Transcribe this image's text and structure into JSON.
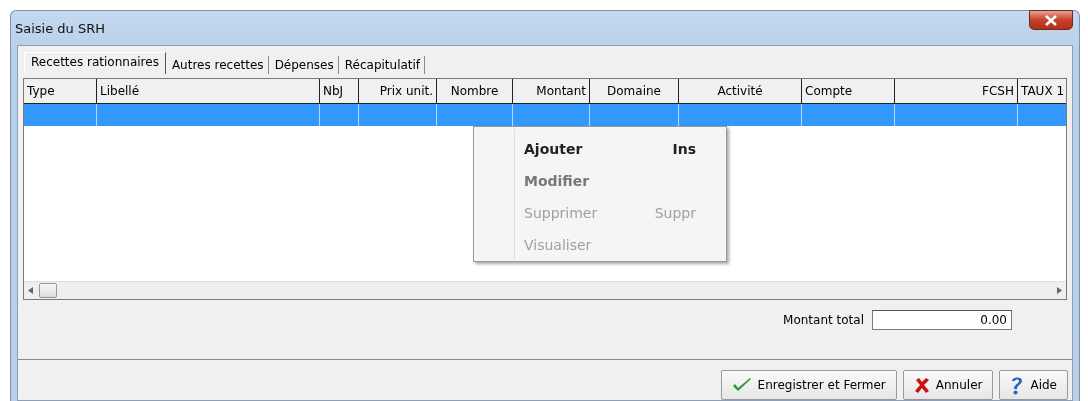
{
  "window": {
    "title": "Saisie du SRH"
  },
  "tabs": [
    {
      "label": "Recettes rationnaires",
      "selected": true
    },
    {
      "label": "Autres recettes",
      "selected": false
    },
    {
      "label": "Dépenses",
      "selected": false
    },
    {
      "label": "Récapitulatif",
      "selected": false
    }
  ],
  "table": {
    "columns": [
      {
        "label": "Type"
      },
      {
        "label": "Libellé"
      },
      {
        "label": "NbJ"
      },
      {
        "label": "Prix unit."
      },
      {
        "label": "Nombre"
      },
      {
        "label": "Montant"
      },
      {
        "label": "Domaine"
      },
      {
        "label": "Activité"
      },
      {
        "label": "Compte"
      },
      {
        "label": "FCSH"
      },
      {
        "label": "TAUX 1"
      }
    ],
    "rows": [
      {
        "selected": true
      }
    ]
  },
  "context_menu": [
    {
      "label": "Ajouter",
      "shortcut": "Ins",
      "bold": true,
      "disabled": false
    },
    {
      "label": "Modifier",
      "bold": true,
      "disabled": true
    },
    {
      "label": "Supprimer",
      "shortcut": "Suppr",
      "bold": false,
      "disabled": true
    },
    {
      "label": "Visualiser",
      "bold": false,
      "disabled": true
    }
  ],
  "total": {
    "label": "Montant total",
    "value": "0.00"
  },
  "buttons": [
    {
      "label": "Enregistrer et Fermer"
    },
    {
      "label": "Annuler"
    },
    {
      "label": "Aide"
    }
  ]
}
